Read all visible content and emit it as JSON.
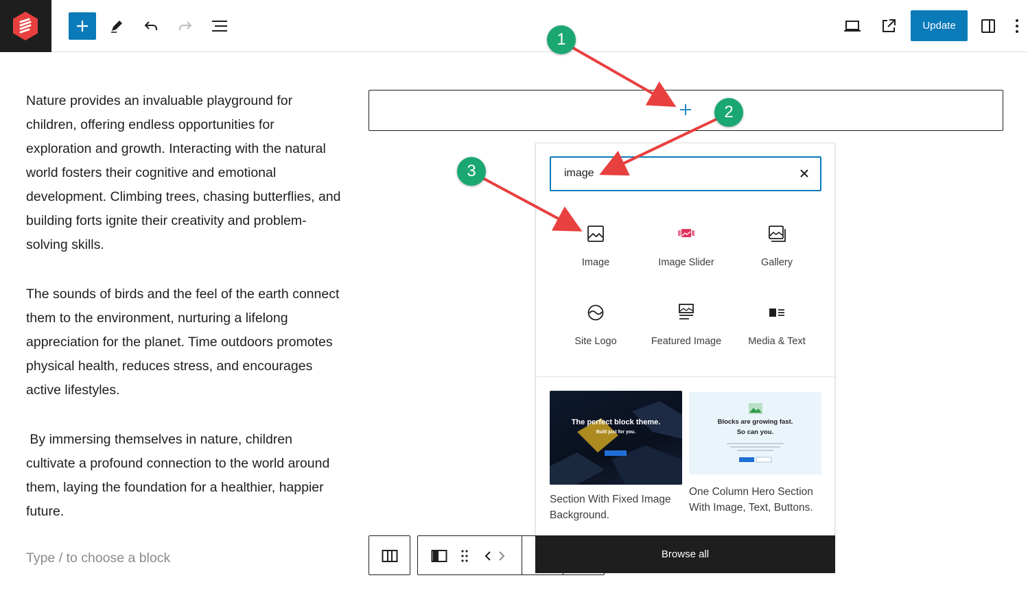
{
  "toolbar": {
    "update_label": "Update",
    "icons": [
      "wordpress-logo-icon",
      "plus-icon",
      "pencil-icon",
      "undo-icon",
      "redo-icon",
      "list-view-icon",
      "desktop-preview-icon",
      "external-link-icon",
      "sidebar-toggle-icon",
      "more-options-icon"
    ]
  },
  "content": {
    "paragraphs": [
      "Nature provides an invaluable playground for children, offering endless opportunities for exploration and growth. Interacting with the natural world fosters their cognitive and emotional development. Climbing trees, chasing butterflies, and building forts ignite their creativity and problem-solving skills.",
      "The sounds of birds and the feel of the earth connect them to the environment, nurturing a lifelong appreciation for the planet. Time outdoors promotes physical health, reduces stress, and encourages active lifestyles.",
      " By immersing themselves in nature, children cultivate a profound connection to the world around them, laying the foundation for a healthier, happier future."
    ],
    "placeholder": "Type / to choose a block"
  },
  "inserter": {
    "search_value": "image",
    "blocks": [
      {
        "label": "Image",
        "icon": "image-icon"
      },
      {
        "label": "Image Slider",
        "icon": "image-slider-icon"
      },
      {
        "label": "Gallery",
        "icon": "gallery-icon"
      },
      {
        "label": "Site Logo",
        "icon": "site-logo-icon"
      },
      {
        "label": "Featured Image",
        "icon": "featured-image-icon"
      },
      {
        "label": "Media & Text",
        "icon": "media-text-icon"
      }
    ],
    "patterns": [
      {
        "label": "Section With Fixed Image Background.",
        "thumb_title": "The perfect block theme.",
        "thumb_subtitle": "Built just for you."
      },
      {
        "label": "One Column Hero Section With Image, Text, Buttons.",
        "thumb_title": "Blocks are growing fast.",
        "thumb_subtitle": "So can you."
      }
    ],
    "browse_all_label": "Browse all"
  },
  "callouts": [
    "1",
    "2",
    "3"
  ],
  "colors": {
    "accent": "#0a7ab8",
    "callout": "#1aa772",
    "arrow": "#e8403f",
    "slider_icon": "#e0325d"
  }
}
